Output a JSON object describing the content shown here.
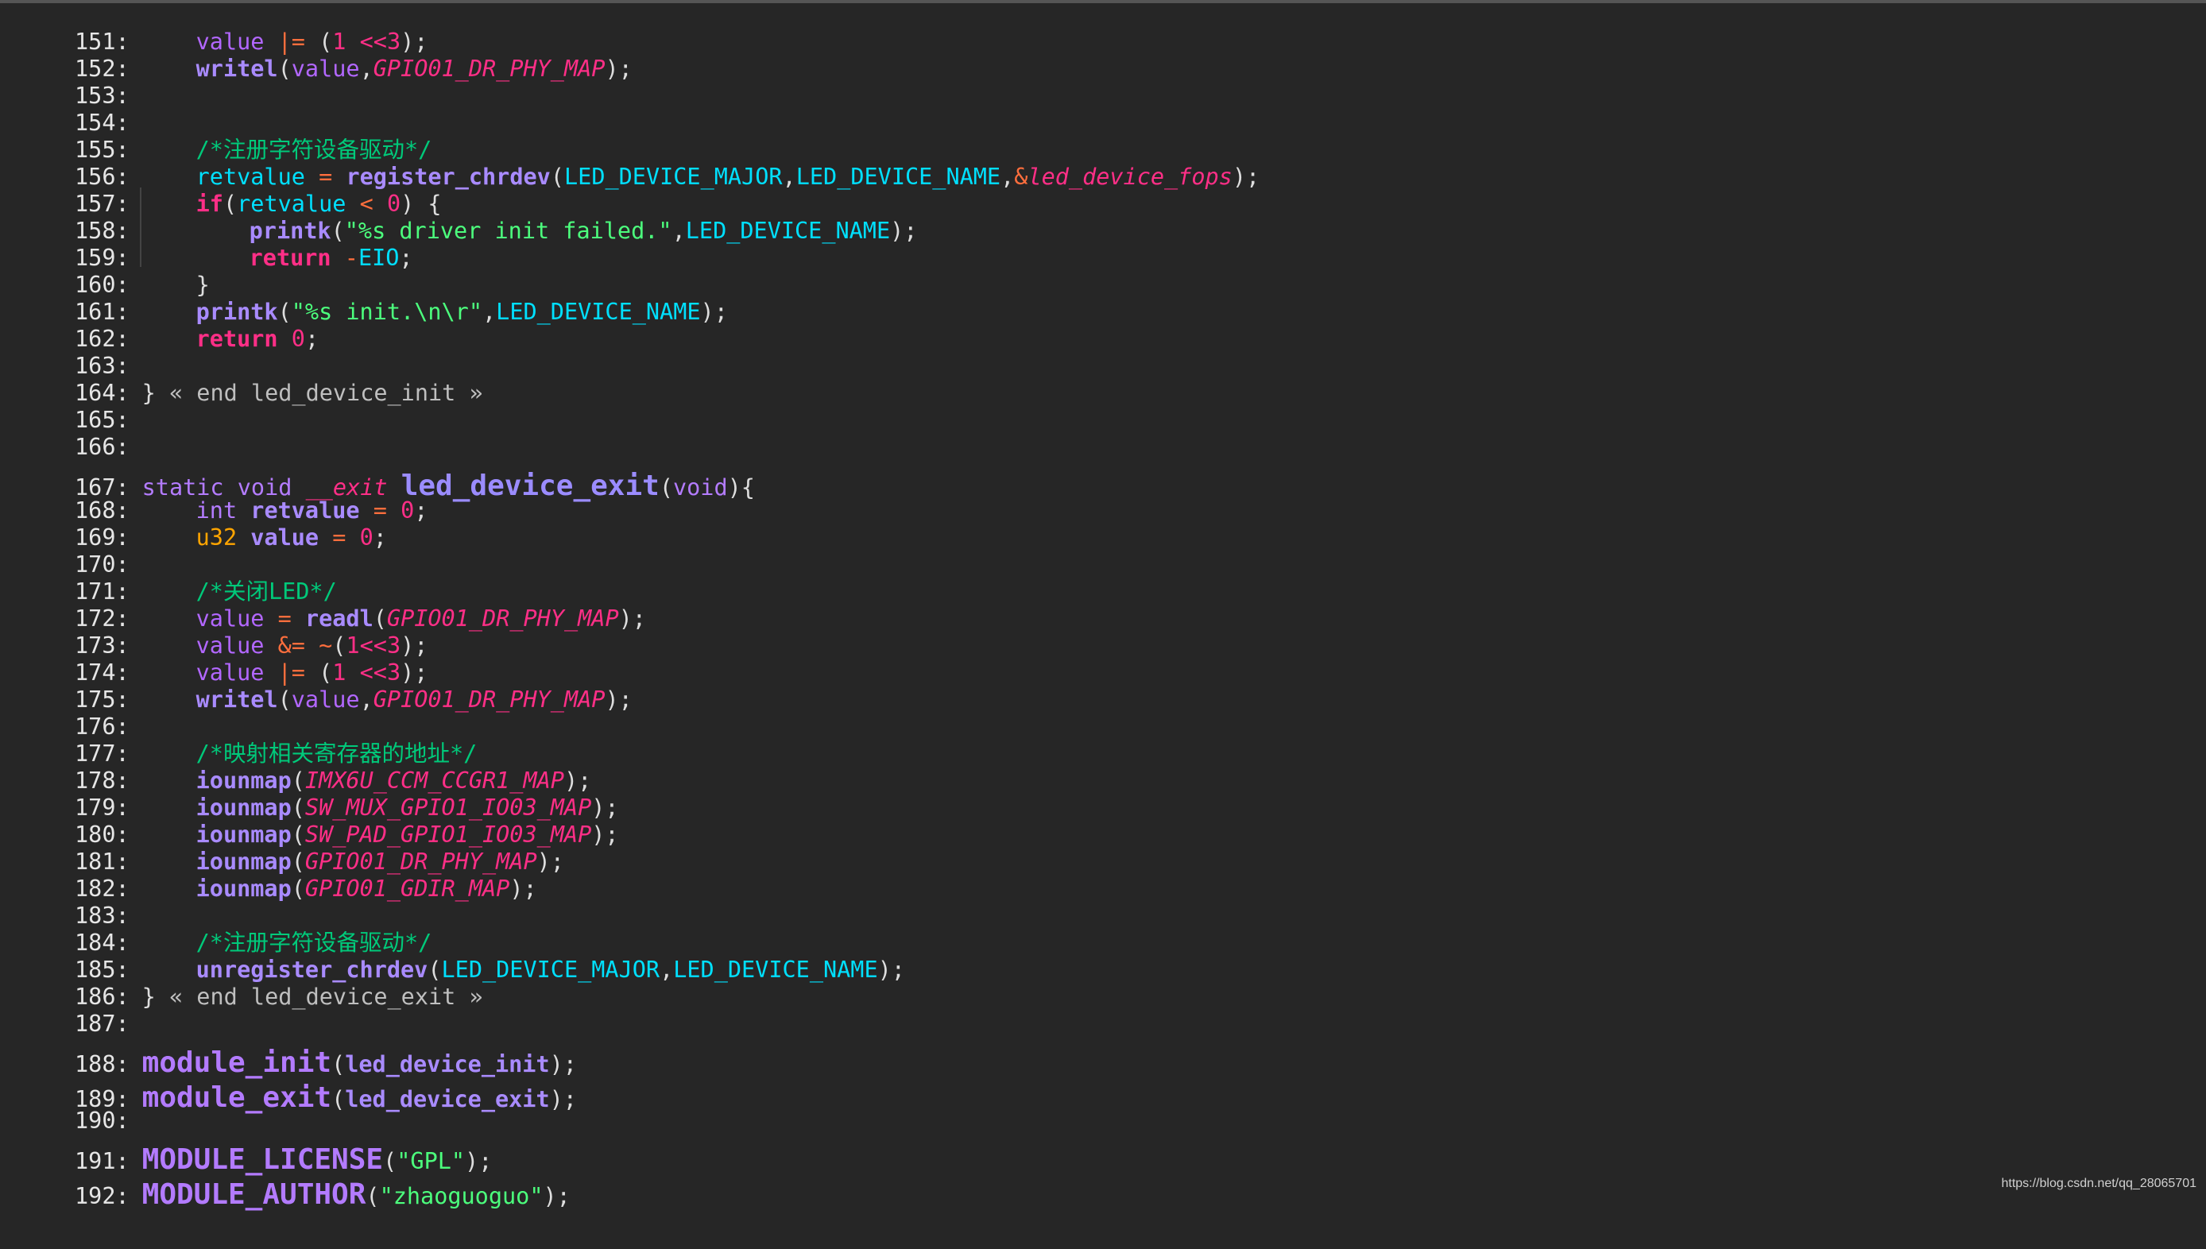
{
  "watermark": "https://blog.csdn.net/qq_28065701",
  "lines": [
    {
      "no": "151:",
      "text": "value |= (1 <<3);"
    },
    {
      "no": "152:",
      "text": "writel(value,GPIO01_DR_PHY_MAP);"
    },
    {
      "no": "153:",
      "text": ""
    },
    {
      "no": "154:",
      "text": ""
    },
    {
      "no": "155:",
      "text": "/*注册字符设备驱动*/"
    },
    {
      "no": "156:",
      "text": "retvalue = register_chrdev(LED_DEVICE_MAJOR,LED_DEVICE_NAME,&led_device_fops);"
    },
    {
      "no": "157:",
      "text": "if(retvalue < 0) {"
    },
    {
      "no": "158:",
      "text": "printk(\"%s driver init failed.\",LED_DEVICE_NAME);"
    },
    {
      "no": "159:",
      "text": "return -EIO;"
    },
    {
      "no": "160:",
      "text": "}"
    },
    {
      "no": "161:",
      "text": "printk(\"%s init.\\n\\r\",LED_DEVICE_NAME);"
    },
    {
      "no": "162:",
      "text": "return 0;"
    },
    {
      "no": "163:",
      "text": ""
    },
    {
      "no": "164:",
      "text": "} « end led_device_init »"
    },
    {
      "no": "165:",
      "text": ""
    },
    {
      "no": "166:",
      "text": ""
    },
    {
      "no": "167:",
      "text": "static void __exit led_device_exit(void){"
    },
    {
      "no": "168:",
      "text": "int retvalue = 0;"
    },
    {
      "no": "169:",
      "text": "u32 value = 0;"
    },
    {
      "no": "170:",
      "text": ""
    },
    {
      "no": "171:",
      "text": "/*关闭LED*/"
    },
    {
      "no": "172:",
      "text": "value = readl(GPIO01_DR_PHY_MAP);"
    },
    {
      "no": "173:",
      "text": "value &= ~(1<<3);"
    },
    {
      "no": "174:",
      "text": "value |= (1 <<3);"
    },
    {
      "no": "175:",
      "text": "writel(value,GPIO01_DR_PHY_MAP);"
    },
    {
      "no": "176:",
      "text": ""
    },
    {
      "no": "177:",
      "text": "/*映射相关寄存器的地址*/"
    },
    {
      "no": "178:",
      "text": "iounmap(IMX6U_CCM_CCGR1_MAP);"
    },
    {
      "no": "179:",
      "text": "iounmap(SW_MUX_GPIO1_IO03_MAP);"
    },
    {
      "no": "180:",
      "text": "iounmap(SW_PAD_GPIO1_IO03_MAP);"
    },
    {
      "no": "181:",
      "text": "iounmap(GPIO01_DR_PHY_MAP);"
    },
    {
      "no": "182:",
      "text": "iounmap(GPIO01_GDIR_MAP);"
    },
    {
      "no": "183:",
      "text": ""
    },
    {
      "no": "184:",
      "text": "/*注册字符设备驱动*/"
    },
    {
      "no": "185:",
      "text": "unregister_chrdev(LED_DEVICE_MAJOR,LED_DEVICE_NAME);"
    },
    {
      "no": "186:",
      "text": "} « end led_device_exit »"
    },
    {
      "no": "187:",
      "text": ""
    },
    {
      "no": "188:",
      "text": "module_init(led_device_init);"
    },
    {
      "no": "189:",
      "text": "module_exit(led_device_exit);"
    },
    {
      "no": "190:",
      "text": ""
    },
    {
      "no": "191:",
      "text": "MODULE_LICENSE(\"GPL\");"
    },
    {
      "no": "192:",
      "text": "MODULE_AUTHOR(\"zhaoguoguo\");"
    }
  ],
  "tokens": {
    "l151": [
      "value",
      "|=",
      "(",
      "1",
      "<<",
      "3",
      ");"
    ],
    "l152": [
      "writel",
      "(",
      "value",
      ",",
      "GPIO01_DR_PHY_MAP",
      ");"
    ],
    "l155": [
      "/*注册字符设备驱动*/"
    ],
    "l156": [
      "retvalue",
      "=",
      "register_chrdev",
      "(",
      "LED_DEVICE_MAJOR",
      ",",
      "LED_DEVICE_NAME",
      ",",
      "&",
      "led_device_fops",
      ");"
    ],
    "l157": [
      "if",
      "(",
      "retvalue",
      "<",
      "0",
      ") {"
    ],
    "l158": [
      "printk",
      "(",
      "\"%s driver init failed.\"",
      ",",
      "LED_DEVICE_NAME",
      ");"
    ],
    "l159": [
      "return",
      "-",
      "EIO",
      ";"
    ],
    "l160": [
      "}"
    ],
    "l161": [
      "printk",
      "(",
      "\"%s init.\\n\\r\"",
      ",",
      "LED_DEVICE_NAME",
      ");"
    ],
    "l162": [
      "return",
      "0",
      ";"
    ],
    "l164": [
      "}",
      "« end led_device_init »"
    ],
    "l167": [
      "static",
      "void",
      "__exit",
      "led_device_exit",
      "(",
      "void",
      "){"
    ],
    "l168": [
      "int",
      "retvalue",
      "=",
      "0",
      ";"
    ],
    "l169": [
      "u32",
      "value",
      "=",
      "0",
      ";"
    ],
    "l171": [
      "/*关闭LED*/"
    ],
    "l172": [
      "value",
      "=",
      "readl",
      "(",
      "GPIO01_DR_PHY_MAP",
      ");"
    ],
    "l173": [
      "value",
      "&=",
      "~",
      "(",
      "1",
      "<<",
      "3",
      ");"
    ],
    "l174": [
      "value",
      "|=",
      "(",
      "1",
      "<<",
      "3",
      ");"
    ],
    "l175": [
      "writel",
      "(",
      "value",
      ",",
      "GPIO01_DR_PHY_MAP",
      ");"
    ],
    "l177": [
      "/*映射相关寄存器的地址*/"
    ],
    "l178": [
      "iounmap",
      "(",
      "IMX6U_CCM_CCGR1_MAP",
      ");"
    ],
    "l179": [
      "iounmap",
      "(",
      "SW_MUX_GPIO1_IO03_MAP",
      ");"
    ],
    "l180": [
      "iounmap",
      "(",
      "SW_PAD_GPIO1_IO03_MAP",
      ");"
    ],
    "l181": [
      "iounmap",
      "(",
      "GPIO01_DR_PHY_MAP",
      ");"
    ],
    "l182": [
      "iounmap",
      "(",
      "GPIO01_GDIR_MAP",
      ");"
    ],
    "l184": [
      "/*注册字符设备驱动*/"
    ],
    "l185": [
      "unregister_chrdev",
      "(",
      "LED_DEVICE_MAJOR",
      ",",
      "LED_DEVICE_NAME",
      ");"
    ],
    "l186": [
      "}",
      "« end led_device_exit »"
    ],
    "l188": [
      "module_init",
      "(",
      "led_device_init",
      ");"
    ],
    "l189": [
      "module_exit",
      "(",
      "led_device_exit",
      ");"
    ],
    "l191": [
      "MODULE_LICENSE",
      "(",
      "\"GPL\"",
      ");"
    ],
    "l192": [
      "MODULE_AUTHOR",
      "(",
      "\"zhaoguoguo\"",
      ");"
    ]
  }
}
